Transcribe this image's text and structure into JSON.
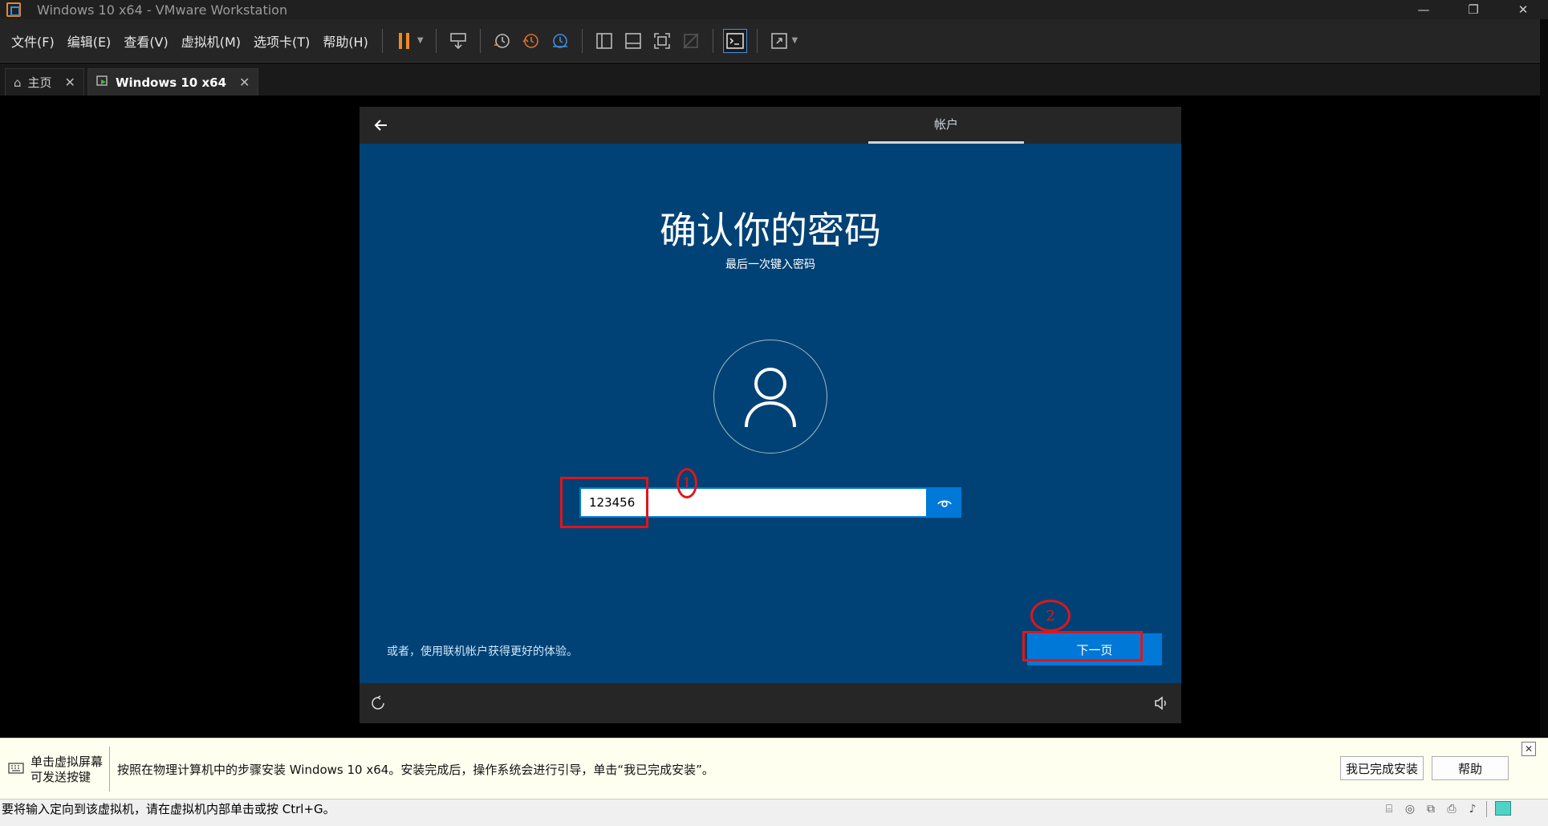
{
  "window": {
    "title": "Windows 10 x64 - VMware Workstation",
    "minimize_glyph": "—",
    "restore_glyph": "❐",
    "close_glyph": "✕"
  },
  "menu": {
    "file": "文件(F)",
    "edit": "编辑(E)",
    "view": "查看(V)",
    "vm": "虚拟机(M)",
    "tabs": "选项卡(T)",
    "help": "帮助(H)"
  },
  "tabs": [
    {
      "label": "主页",
      "icon": "home-icon",
      "close": "✕"
    },
    {
      "label": "Windows 10 x64",
      "icon": "vm-running-icon",
      "close": "✕"
    }
  ],
  "oobe": {
    "section_tab": "帐户",
    "title": "确认你的密码",
    "subtitle": "最后一次键入密码",
    "password_value": "123456",
    "online_link": "或者，使用联机帐户获得更好的体验。",
    "next_button": "下一页"
  },
  "annotations": {
    "one": "1",
    "two": "2",
    "color": "#e0151b"
  },
  "hintbar": {
    "left_line1": "单击虚拟屏幕",
    "left_line2": "可发送按键",
    "message": "按照在物理计算机中的步骤安装 Windows 10 x64。安装完成后，操作系统会进行引导，单击“我已完成安装”。",
    "done_button": "我已完成安装",
    "help_button": "帮助",
    "close_glyph": "✕"
  },
  "statusbar": {
    "text": "要将输入定向到该虚拟机，请在虚拟机内部单击或按 Ctrl+G。"
  },
  "colors": {
    "oobe_bg": "#004275",
    "accent": "#0078d7",
    "chrome": "#252526"
  }
}
